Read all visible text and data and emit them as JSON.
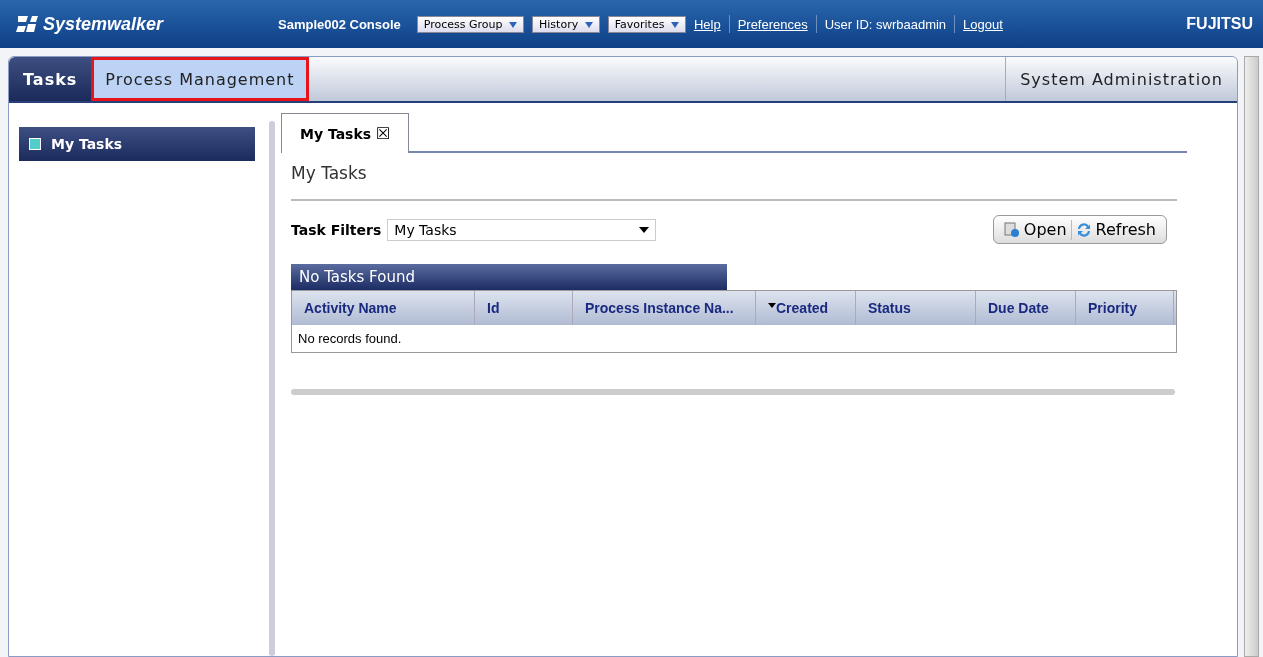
{
  "header": {
    "logo": "Systemwalker",
    "console": "Sample002 Console",
    "menus": [
      {
        "label": "Process Group"
      },
      {
        "label": "History"
      },
      {
        "label": "Favorites"
      }
    ],
    "links": [
      {
        "kind": "link",
        "label": "Help"
      },
      {
        "kind": "link",
        "label": "Preferences"
      },
      {
        "kind": "text",
        "label": "User ID: swrbaadmin"
      },
      {
        "kind": "link",
        "label": "Logout"
      }
    ],
    "brand": "FUJITSU"
  },
  "tabs": [
    {
      "label": "Tasks",
      "selected": true,
      "highlighted": false
    },
    {
      "label": "Process Management",
      "selected": false,
      "highlighted": true
    }
  ],
  "right_tab": {
    "label": "System Administration"
  },
  "sidebar": {
    "items": [
      {
        "label": "My Tasks",
        "selected": true
      }
    ]
  },
  "content_tabs": [
    {
      "label": "My Tasks",
      "close": "☒"
    }
  ],
  "page_title": "My Tasks",
  "filter": {
    "label": "Task Filters",
    "value": "My Tasks"
  },
  "buttons": [
    {
      "label": "Open",
      "kind": "open"
    },
    {
      "label": "Refresh",
      "kind": "refresh"
    }
  ],
  "table": {
    "title": "No Tasks Found",
    "columns": [
      {
        "label": "Activity Name",
        "sorted": false
      },
      {
        "label": "Id",
        "sorted": false
      },
      {
        "label": "Process Instance Na...",
        "sorted": false
      },
      {
        "label": "Created",
        "sorted": true
      },
      {
        "label": "Status",
        "sorted": false
      },
      {
        "label": "Due Date",
        "sorted": false
      },
      {
        "label": "Priority",
        "sorted": false
      }
    ],
    "empty": "No records found."
  }
}
